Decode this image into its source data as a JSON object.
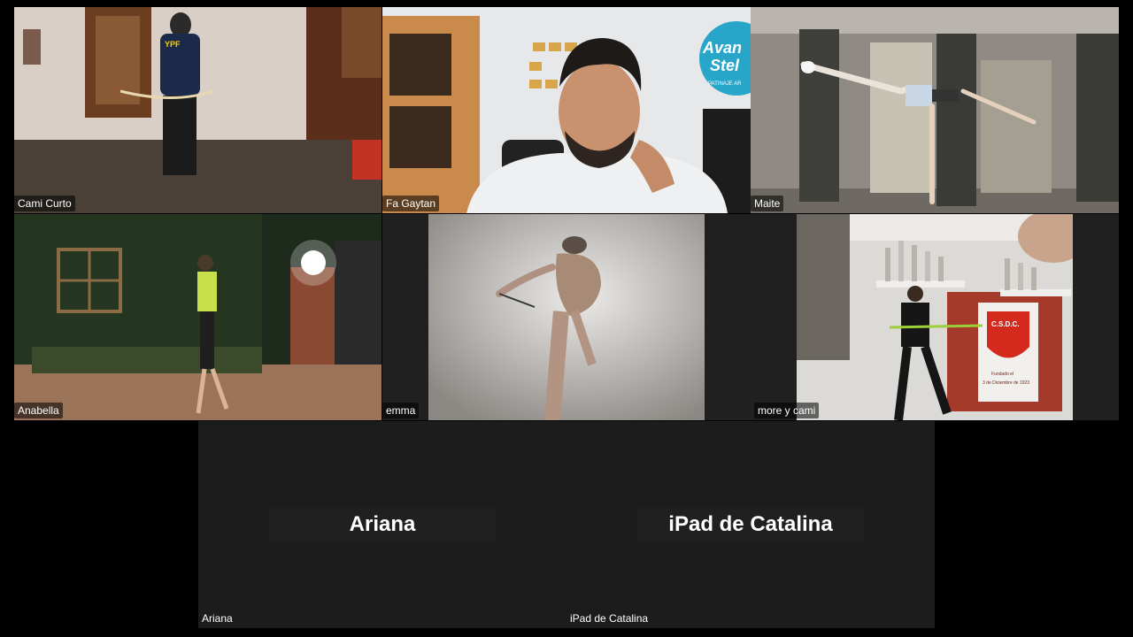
{
  "participants": [
    {
      "name": "Cami Curto"
    },
    {
      "name": "Fa Gaytan"
    },
    {
      "name": "Maite"
    },
    {
      "name": "Anabella"
    },
    {
      "name": "emma"
    },
    {
      "name": "more y cami"
    },
    {
      "name": "Ariana",
      "display_name": "Ariana"
    },
    {
      "name": "iPad de Catalina",
      "display_name": "iPad de Catalina"
    }
  ],
  "scene_text": {
    "shirt": "YPF",
    "banner_line1": "Avan",
    "banner_line2": "Stel",
    "banner_sub": "PATINAJE AR",
    "flag_letters": "C.S.D.C.",
    "flag_line1": "Fundado el",
    "flag_line2": "3 de Diciembre de 1923"
  },
  "colors": {
    "background": "#000000",
    "tile_off": "#1c1c1c",
    "name_text": "#ffffff"
  }
}
